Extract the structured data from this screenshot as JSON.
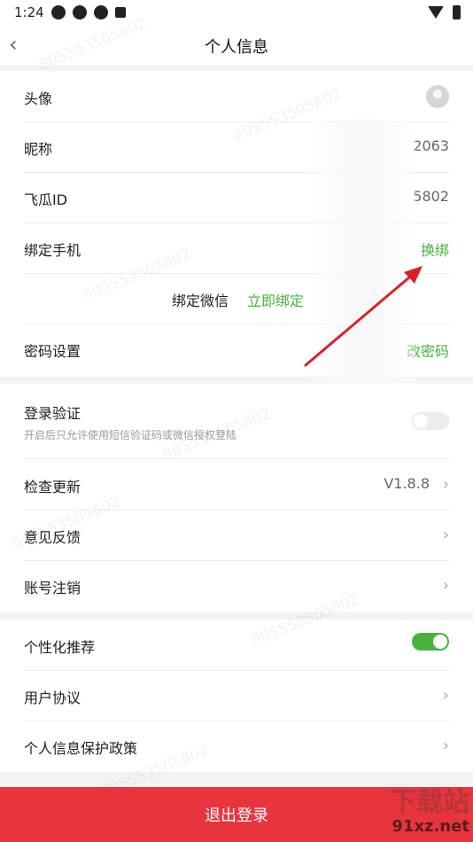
{
  "status": {
    "time": "1:24"
  },
  "header": {
    "title": "个人信息"
  },
  "profile": {
    "avatar_label": "头像",
    "nickname_label": "昵称",
    "nickname_value": "2063",
    "id_label": "飞瓜ID",
    "id_value": "5802",
    "phone_label": "绑定手机",
    "phone_action": "换绑",
    "wechat_label": "绑定微信",
    "wechat_action": "立即绑定",
    "password_label": "密码设置",
    "password_action": "改密码"
  },
  "security": {
    "login_verify_label": "登录验证",
    "login_verify_desc": "开启后只允许使用短信验证码或微信授权登陆",
    "login_verify_on": false,
    "update_label": "检查更新",
    "update_version": "V1.8.8",
    "feedback_label": "意见反馈",
    "cancel_account_label": "账号注销"
  },
  "privacy": {
    "personalized_label": "个性化推荐",
    "personalized_on": true,
    "agreement_label": "用户协议",
    "privacy_policy_label": "个人信息保护政策"
  },
  "logout_label": "退出登录",
  "watermark_text": "805553505802",
  "brand": {
    "name": "下载站",
    "domain": "91xz.net"
  },
  "colors": {
    "accent_green": "#46b43c",
    "logout_red": "#e8343c",
    "arrow_red": "#d8202a"
  }
}
